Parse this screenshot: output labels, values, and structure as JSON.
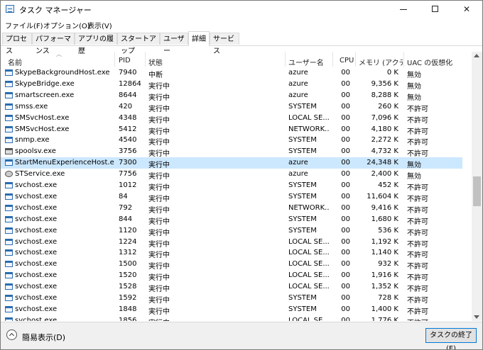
{
  "window": {
    "title": "タスク マネージャー"
  },
  "menu": [
    "ファイル(F)",
    "オプション(O)",
    "表示(V)"
  ],
  "tabs": [
    "プロセス",
    "パフォーマンス",
    "アプリの履歴",
    "スタートアップ",
    "ユーザー",
    "詳細",
    "サービス"
  ],
  "active_tab": "詳細",
  "columns": {
    "name": "名前",
    "pid": "PID",
    "status": "状態",
    "user": "ユーザー名",
    "cpu": "CPU",
    "mem": "メモリ (アクティ...",
    "uac": "UAC の仮想化"
  },
  "rows": [
    {
      "name": "SkypeBackgroundHost.exe",
      "pid": "7940",
      "status": "中断",
      "user": "azure",
      "cpu": "00",
      "mem": "0 K",
      "uac": "無効",
      "icon": "app-icon"
    },
    {
      "name": "SkypeBridge.exe",
      "pid": "12864",
      "status": "実行中",
      "user": "azure",
      "cpu": "00",
      "mem": "9,356 K",
      "uac": "無効",
      "icon": "app-icon"
    },
    {
      "name": "smartscreen.exe",
      "pid": "8644",
      "status": "実行中",
      "user": "azure",
      "cpu": "00",
      "mem": "8,288 K",
      "uac": "無効",
      "icon": "app-icon"
    },
    {
      "name": "smss.exe",
      "pid": "420",
      "status": "実行中",
      "user": "SYSTEM",
      "cpu": "00",
      "mem": "260 K",
      "uac": "不許可",
      "icon": "app-icon"
    },
    {
      "name": "SMSvcHost.exe",
      "pid": "4348",
      "status": "実行中",
      "user": "LOCAL SE...",
      "cpu": "00",
      "mem": "7,096 K",
      "uac": "不許可",
      "icon": "app-icon"
    },
    {
      "name": "SMSvcHost.exe",
      "pid": "5412",
      "status": "実行中",
      "user": "NETWORK...",
      "cpu": "00",
      "mem": "4,180 K",
      "uac": "不許可",
      "icon": "app-icon"
    },
    {
      "name": "snmp.exe",
      "pid": "4540",
      "status": "実行中",
      "user": "SYSTEM",
      "cpu": "00",
      "mem": "2,272 K",
      "uac": "不許可",
      "icon": "app-icon"
    },
    {
      "name": "spoolsv.exe",
      "pid": "3756",
      "status": "実行中",
      "user": "SYSTEM",
      "cpu": "00",
      "mem": "4,732 K",
      "uac": "不許可",
      "icon": "printer-icon"
    },
    {
      "name": "StartMenuExperienceHost.exe",
      "pid": "7300",
      "status": "実行中",
      "user": "azure",
      "cpu": "00",
      "mem": "24,348 K",
      "uac": "無効",
      "icon": "app-icon",
      "selected": true
    },
    {
      "name": "STService.exe",
      "pid": "7756",
      "status": "実行中",
      "user": "azure",
      "cpu": "00",
      "mem": "2,400 K",
      "uac": "無効",
      "icon": "gear-icon"
    },
    {
      "name": "svchost.exe",
      "pid": "1012",
      "status": "実行中",
      "user": "SYSTEM",
      "cpu": "00",
      "mem": "452 K",
      "uac": "不許可",
      "icon": "app-icon"
    },
    {
      "name": "svchost.exe",
      "pid": "84",
      "status": "実行中",
      "user": "SYSTEM",
      "cpu": "00",
      "mem": "11,604 K",
      "uac": "不許可",
      "icon": "app-icon"
    },
    {
      "name": "svchost.exe",
      "pid": "792",
      "status": "実行中",
      "user": "NETWORK...",
      "cpu": "00",
      "mem": "9,416 K",
      "uac": "不許可",
      "icon": "app-icon"
    },
    {
      "name": "svchost.exe",
      "pid": "844",
      "status": "実行中",
      "user": "SYSTEM",
      "cpu": "00",
      "mem": "1,680 K",
      "uac": "不許可",
      "icon": "app-icon"
    },
    {
      "name": "svchost.exe",
      "pid": "1120",
      "status": "実行中",
      "user": "SYSTEM",
      "cpu": "00",
      "mem": "536 K",
      "uac": "不許可",
      "icon": "app-icon"
    },
    {
      "name": "svchost.exe",
      "pid": "1224",
      "status": "実行中",
      "user": "LOCAL SE...",
      "cpu": "00",
      "mem": "1,192 K",
      "uac": "不許可",
      "icon": "app-icon"
    },
    {
      "name": "svchost.exe",
      "pid": "1312",
      "status": "実行中",
      "user": "LOCAL SE...",
      "cpu": "00",
      "mem": "1,140 K",
      "uac": "不許可",
      "icon": "app-icon"
    },
    {
      "name": "svchost.exe",
      "pid": "1500",
      "status": "実行中",
      "user": "LOCAL SE...",
      "cpu": "00",
      "mem": "932 K",
      "uac": "不許可",
      "icon": "app-icon"
    },
    {
      "name": "svchost.exe",
      "pid": "1520",
      "status": "実行中",
      "user": "LOCAL SE...",
      "cpu": "00",
      "mem": "1,916 K",
      "uac": "不許可",
      "icon": "app-icon"
    },
    {
      "name": "svchost.exe",
      "pid": "1528",
      "status": "実行中",
      "user": "LOCAL SE...",
      "cpu": "00",
      "mem": "1,352 K",
      "uac": "不許可",
      "icon": "app-icon"
    },
    {
      "name": "svchost.exe",
      "pid": "1592",
      "status": "実行中",
      "user": "SYSTEM",
      "cpu": "00",
      "mem": "728 K",
      "uac": "不許可",
      "icon": "app-icon"
    },
    {
      "name": "svchost.exe",
      "pid": "1848",
      "status": "実行中",
      "user": "SYSTEM",
      "cpu": "00",
      "mem": "1,400 K",
      "uac": "不許可",
      "icon": "app-icon"
    },
    {
      "name": "svchost.exe",
      "pid": "1856",
      "status": "実行中",
      "user": "LOCAL SE...",
      "cpu": "00",
      "mem": "1,776 K",
      "uac": "不許可",
      "icon": "app-icon"
    }
  ],
  "footer": {
    "fewer_details": "簡易表示(D)",
    "end_task": "タスクの終了(E)"
  },
  "colors": {
    "selected_row": "#cce8ff",
    "accent": "#0078d7"
  }
}
